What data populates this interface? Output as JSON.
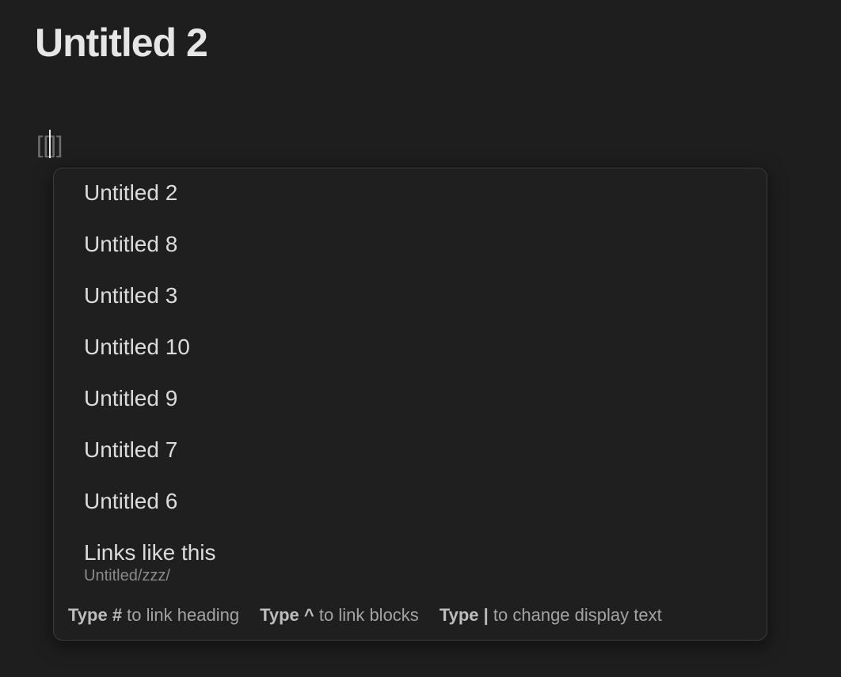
{
  "note": {
    "title": "Untitled 2",
    "editor": {
      "open_brackets": "[[",
      "close_brackets": "]]"
    }
  },
  "link_suggest": {
    "items": [
      {
        "title": "Untitled 2",
        "path": ""
      },
      {
        "title": "Untitled 8",
        "path": ""
      },
      {
        "title": "Untitled 3",
        "path": ""
      },
      {
        "title": "Untitled 10",
        "path": ""
      },
      {
        "title": "Untitled 9",
        "path": ""
      },
      {
        "title": "Untitled 7",
        "path": ""
      },
      {
        "title": "Untitled 6",
        "path": ""
      },
      {
        "title": "Links like this",
        "path": "Untitled/zzz/"
      }
    ],
    "footer": {
      "hint_heading_key": "Type #",
      "hint_heading_text": " to link heading",
      "hint_blocks_key": "Type ^",
      "hint_blocks_text": " to link blocks",
      "hint_display_key": "Type |",
      "hint_display_text": " to change display text"
    }
  }
}
